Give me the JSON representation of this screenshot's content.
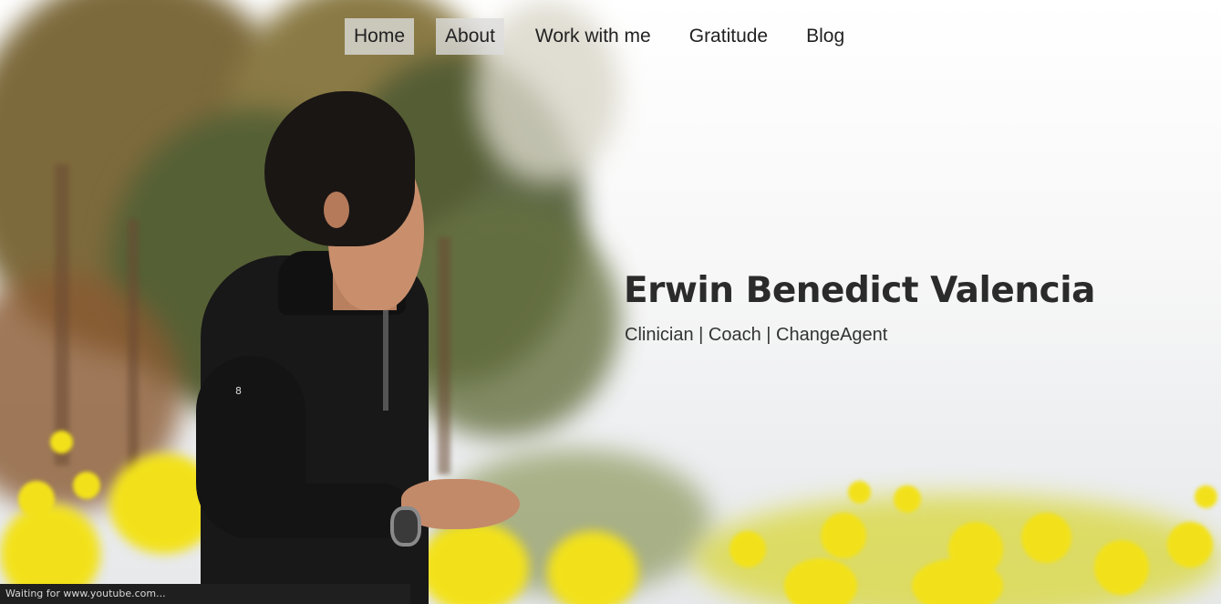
{
  "nav": {
    "items": [
      {
        "label": "Home"
      },
      {
        "label": "About"
      },
      {
        "label": "Work with me"
      },
      {
        "label": "Gratitude"
      },
      {
        "label": "Blog"
      }
    ]
  },
  "hero": {
    "name": "Erwin Benedict Valencia",
    "tagline": "Clinician | Coach | ChangeAgent",
    "badge_text": "8"
  },
  "browser": {
    "status_text": "Waiting for www.youtube.com..."
  },
  "colors": {
    "flower_yellow": "#f2e11a",
    "text_dark": "#2b2b2b",
    "nav_highlight": "#dcdcdc"
  }
}
